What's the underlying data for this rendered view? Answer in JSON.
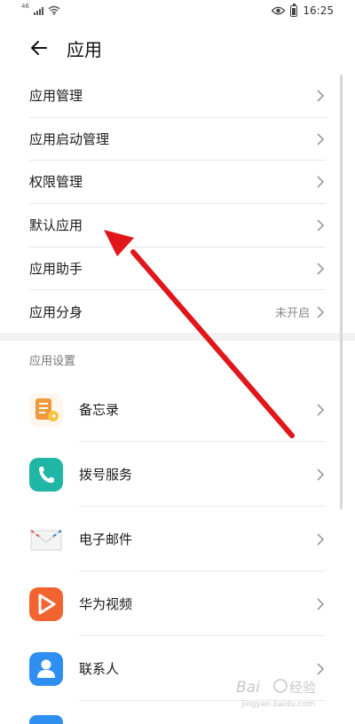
{
  "status_bar": {
    "network": "46",
    "time": "16:25",
    "icons": [
      "signal-icon",
      "wifi-icon",
      "eye-icon",
      "battery-icon"
    ]
  },
  "header": {
    "title": "应用",
    "back_icon": "back-arrow-icon"
  },
  "main_list": [
    {
      "label": "应用管理",
      "value": ""
    },
    {
      "label": "应用启动管理",
      "value": ""
    },
    {
      "label": "权限管理",
      "value": ""
    },
    {
      "label": "默认应用",
      "value": ""
    },
    {
      "label": "应用助手",
      "value": ""
    },
    {
      "label": "应用分身",
      "value": "未开启"
    }
  ],
  "app_settings": {
    "section_title": "应用设置",
    "apps": [
      {
        "label": "备忘录",
        "icon": "notepad-icon",
        "color": "#f0993a"
      },
      {
        "label": "拨号服务",
        "icon": "phone-icon",
        "color": "#1fb6a6"
      },
      {
        "label": "电子邮件",
        "icon": "mail-icon",
        "color": "#f4f4f4"
      },
      {
        "label": "华为视频",
        "icon": "video-play-icon",
        "color": "#f2642f"
      },
      {
        "label": "联系人",
        "icon": "contacts-icon",
        "color": "#2e8ff0"
      }
    ]
  },
  "colors": {
    "annotation_arrow": "#e0161b",
    "chevron": "#9a9a9a"
  },
  "watermark": {
    "text": "Baidu经验",
    "subtext": "jingyan.baidu.com"
  }
}
